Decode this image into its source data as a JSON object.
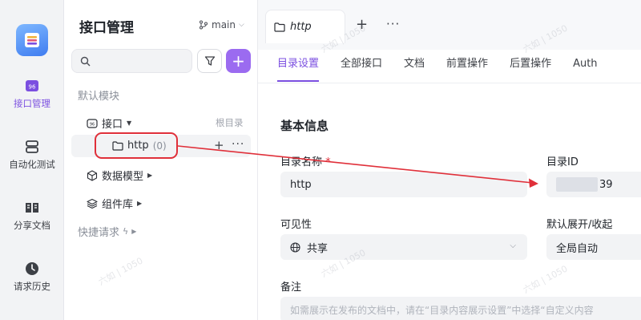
{
  "rail": {
    "items": [
      {
        "label": "接口管理",
        "icon": "api-icon",
        "active": true
      },
      {
        "label": "自动化测试",
        "icon": "automation-icon",
        "active": false
      },
      {
        "label": "分享文档",
        "icon": "book-icon",
        "active": false
      },
      {
        "label": "请求历史",
        "icon": "clock-icon",
        "active": false
      }
    ]
  },
  "tree": {
    "title": "接口管理",
    "branch": "main",
    "search": {
      "placeholder": ""
    },
    "default_module": "默认模块",
    "api_node": "接口",
    "root_dir_hint": "根目录",
    "http_folder": {
      "name": "http",
      "count": "(0)"
    },
    "schemas_node": "数据模型",
    "components_node": "组件库",
    "quick_requests": "快捷请求"
  },
  "main": {
    "file_tab": "http",
    "tabs": [
      "目录设置",
      "全部接口",
      "文档",
      "前置操作",
      "后置操作",
      "Auth"
    ],
    "section_title": "基本信息",
    "dir_name_label": "目录名称",
    "dir_name_value": "http",
    "dir_id_label": "目录ID",
    "dir_id_suffix": "39",
    "visibility_label": "可见性",
    "visibility_value": "共享",
    "expand_label": "默认展开/收起",
    "expand_value": "全局自动",
    "note_label": "备注",
    "note_placeholder": "如需展示在发布的文档中，请在“目录内容展示设置”中选择“自定义内容"
  },
  "watermark_text": "六如 | 1050",
  "colors": {
    "accent": "#7b4fe0",
    "annotation": "#e0303a"
  }
}
